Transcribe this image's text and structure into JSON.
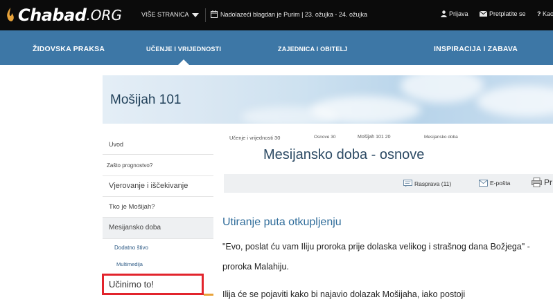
{
  "header": {
    "logo_text": "Chabad",
    "logo_suffix": ".ORG",
    "more_pages": "VIŠE STRANICA",
    "holiday": "Nadolazeći blagdan je Purim | 23. ožujka - 24. ožujka",
    "login": "Prijava",
    "subscribe": "Pretplatite se",
    "help": "Kao"
  },
  "nav": {
    "items": [
      {
        "label": "ŽIDOVSKA PRAKSA"
      },
      {
        "label": "UČENJE I VRIJEDNOSTI"
      },
      {
        "label": "ZAJEDNICA I OBITELJ"
      },
      {
        "label": "INSPIRACIJA I ZABAVA"
      }
    ]
  },
  "banner": {
    "title": "Mošijah 101"
  },
  "sidebar": {
    "items": [
      {
        "label": "Uvod"
      },
      {
        "label": "Zašto prognostvo?"
      },
      {
        "label": "Vjerovanje i iščekivanje"
      },
      {
        "label": "Tko je Mošijah?"
      },
      {
        "label": "Mesijansko doba"
      }
    ],
    "subitems": [
      {
        "label": "Dodatno štivo"
      },
      {
        "label": "Multimedija"
      }
    ],
    "cta": "Učinimo to!"
  },
  "breadcrumb": [
    {
      "label": "Učenje i vrijednosti 30"
    },
    {
      "label": "Osnove 30"
    },
    {
      "label": "Mošijah 101 20"
    },
    {
      "label": "Mesijansko doba"
    }
  ],
  "article": {
    "title": "Mesijansko doba - osnove",
    "toolbar": {
      "discussion": "Rasprava (11)",
      "email": "E-pošta",
      "print": "Pr"
    },
    "section_heading": "Utiranje puta otkupljenju",
    "para1_line1": "\"Evo, poslat ću vam Iliju proroka prije dolaska velikog i strašnog dana Božjega\" -",
    "para1_line2": "proroka Malahiju.",
    "para2_line1": "Ilija će se pojaviti kako bi najavio dolazak Mošijaha, iako postoji"
  }
}
